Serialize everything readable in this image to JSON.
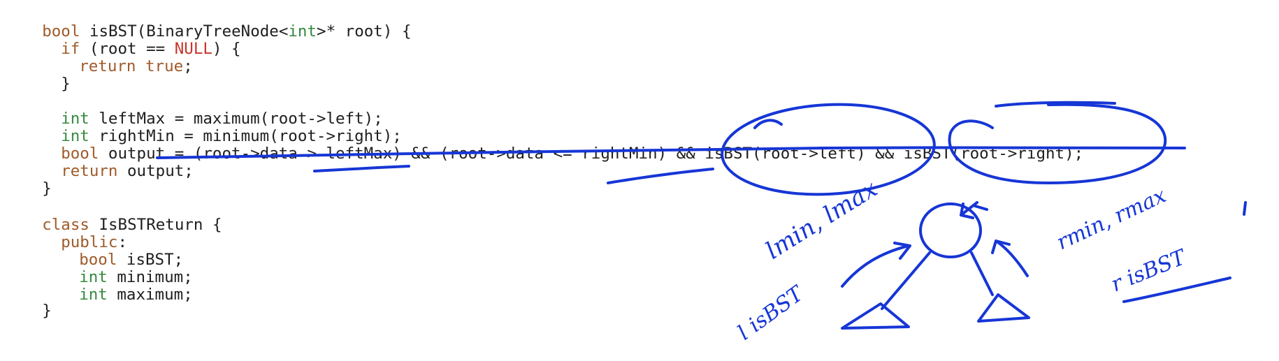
{
  "code": {
    "l1": {
      "kw": "bool",
      "rest": " isBST(BinaryTreeNode<",
      "type": "int",
      "end": ">* root) {"
    },
    "l2": {
      "kw": "if",
      "mid": " (root == ",
      "lit": "NULL",
      "end": ") {"
    },
    "l3": {
      "kw": "return",
      "sp": " ",
      "lit": "true",
      "end": ";"
    },
    "l4": {
      "brace": "}"
    },
    "l6": {
      "type": "int",
      "rest": " leftMax = maximum(root->left);"
    },
    "l7": {
      "type": "int",
      "rest": " rightMin = minimum(root->right);"
    },
    "l8": {
      "kw": "bool",
      "rest": " output = (root->data > leftMax) && (root->data <= rightMin) && isBST(root->left) && isBST(root->right);"
    },
    "l9": {
      "kw": "return",
      "rest": " output;"
    },
    "l10": {
      "brace": "}"
    },
    "l12": {
      "kw": "class",
      "rest": " IsBSTReturn {"
    },
    "l13": {
      "kw": "public",
      "rest": ":"
    },
    "l14": {
      "kw": "bool",
      "rest": " isBST;"
    },
    "l15": {
      "type": "int",
      "rest": " minimum;"
    },
    "l16": {
      "type": "int",
      "rest": " maximum;"
    },
    "l17": {
      "brace": "}"
    }
  },
  "annotations": {
    "left_labels": "lmin, lmax",
    "left_isbst": "l isBST",
    "right_labels": "rmin, rmax",
    "right_isbst": "r isBST"
  },
  "colors": {
    "keyword": "#9f5b2a",
    "type": "#348a3f",
    "literal": "#c8352b",
    "text": "#1e1e1e",
    "ink": "#1636d6"
  }
}
